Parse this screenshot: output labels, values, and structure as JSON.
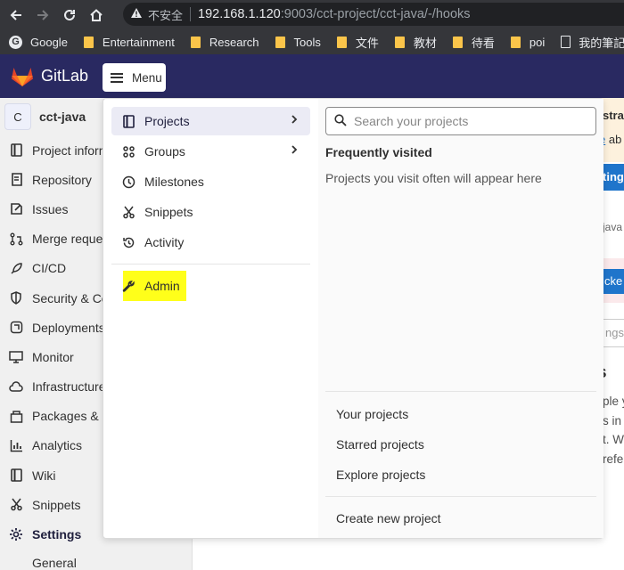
{
  "browser": {
    "url_host": "192.168.1.120",
    "url_rest": ":9003/cct-project/cct-java/-/hooks",
    "insecure_label": "不安全",
    "bookmarks": [
      {
        "label": "Google",
        "icon": "google-icon"
      },
      {
        "label": "Entertainment",
        "icon": "folder-icon"
      },
      {
        "label": "Research",
        "icon": "folder-icon"
      },
      {
        "label": "Tools",
        "icon": "folder-icon"
      },
      {
        "label": "文件",
        "icon": "folder-icon"
      },
      {
        "label": "教材",
        "icon": "folder-icon"
      },
      {
        "label": "待看",
        "icon": "folder-icon"
      },
      {
        "label": "poi",
        "icon": "folder-icon"
      },
      {
        "label": "我的筆記",
        "icon": "page-icon"
      }
    ]
  },
  "header": {
    "brand": "GitLab",
    "menu_label": "Menu",
    "brand_color": "#292961"
  },
  "sidebar": {
    "project_initial": "C",
    "project_name": "cct-java",
    "items": [
      {
        "label": "Project information",
        "icon": "project-icon"
      },
      {
        "label": "Repository",
        "icon": "repository-icon"
      },
      {
        "label": "Issues",
        "icon": "issues-icon"
      },
      {
        "label": "Merge requests",
        "icon": "merge-request-icon"
      },
      {
        "label": "CI/CD",
        "icon": "rocket-icon"
      },
      {
        "label": "Security & Compliance",
        "icon": "shield-icon"
      },
      {
        "label": "Deployments",
        "icon": "deployments-icon"
      },
      {
        "label": "Monitor",
        "icon": "monitor-icon"
      },
      {
        "label": "Infrastructure",
        "icon": "cloud-icon"
      },
      {
        "label": "Packages & Registries",
        "icon": "package-icon"
      },
      {
        "label": "Analytics",
        "icon": "chart-icon"
      },
      {
        "label": "Wiki",
        "icon": "book-icon"
      },
      {
        "label": "Snippets",
        "icon": "scissors-icon"
      },
      {
        "label": "Settings",
        "icon": "gear-icon"
      }
    ],
    "sub_item": "General"
  },
  "background": {
    "alert_title": "strat",
    "alert_body_link": "e",
    "alert_body_text": " ab",
    "blue_button": "ting",
    "edge_text": "java",
    "blue_button2": "cke",
    "input_text": "ngs",
    "heading": "s",
    "para_lines": [
      "ple y",
      "s in",
      "t. W",
      "refe"
    ]
  },
  "menu": {
    "left_items": [
      {
        "label": "Projects",
        "icon": "project-icon",
        "has_chevron": true,
        "active": true
      },
      {
        "label": "Groups",
        "icon": "groups-icon",
        "has_chevron": true,
        "active": false
      },
      {
        "label": "Milestones",
        "icon": "clock-icon",
        "has_chevron": false,
        "active": false
      },
      {
        "label": "Snippets",
        "icon": "scissors-icon",
        "has_chevron": false,
        "active": false
      },
      {
        "label": "Activity",
        "icon": "history-icon",
        "has_chevron": false,
        "active": false
      }
    ],
    "admin_label": "Admin",
    "highlight_color": "#ffff1a",
    "search_placeholder": "Search your projects",
    "frequently_visited_title": "Frequently visited",
    "frequently_visited_desc": "Projects you visit often will appear here",
    "links": [
      "Your projects",
      "Starred projects",
      "Explore projects"
    ],
    "create_link": "Create new project"
  }
}
